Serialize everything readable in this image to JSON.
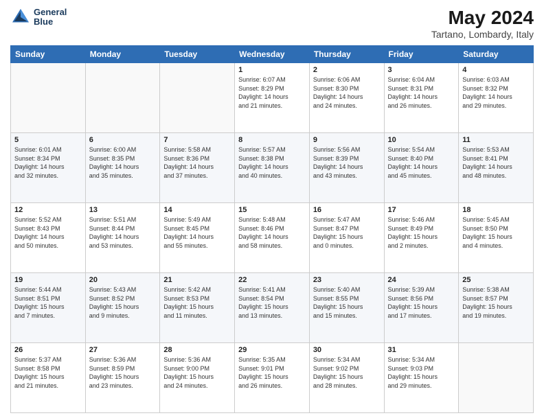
{
  "header": {
    "logo_line1": "General",
    "logo_line2": "Blue",
    "title": "May 2024",
    "subtitle": "Tartano, Lombardy, Italy"
  },
  "days_of_week": [
    "Sunday",
    "Monday",
    "Tuesday",
    "Wednesday",
    "Thursday",
    "Friday",
    "Saturday"
  ],
  "weeks": [
    [
      {
        "day": "",
        "info": ""
      },
      {
        "day": "",
        "info": ""
      },
      {
        "day": "",
        "info": ""
      },
      {
        "day": "1",
        "info": "Sunrise: 6:07 AM\nSunset: 8:29 PM\nDaylight: 14 hours\nand 21 minutes."
      },
      {
        "day": "2",
        "info": "Sunrise: 6:06 AM\nSunset: 8:30 PM\nDaylight: 14 hours\nand 24 minutes."
      },
      {
        "day": "3",
        "info": "Sunrise: 6:04 AM\nSunset: 8:31 PM\nDaylight: 14 hours\nand 26 minutes."
      },
      {
        "day": "4",
        "info": "Sunrise: 6:03 AM\nSunset: 8:32 PM\nDaylight: 14 hours\nand 29 minutes."
      }
    ],
    [
      {
        "day": "5",
        "info": "Sunrise: 6:01 AM\nSunset: 8:34 PM\nDaylight: 14 hours\nand 32 minutes."
      },
      {
        "day": "6",
        "info": "Sunrise: 6:00 AM\nSunset: 8:35 PM\nDaylight: 14 hours\nand 35 minutes."
      },
      {
        "day": "7",
        "info": "Sunrise: 5:58 AM\nSunset: 8:36 PM\nDaylight: 14 hours\nand 37 minutes."
      },
      {
        "day": "8",
        "info": "Sunrise: 5:57 AM\nSunset: 8:38 PM\nDaylight: 14 hours\nand 40 minutes."
      },
      {
        "day": "9",
        "info": "Sunrise: 5:56 AM\nSunset: 8:39 PM\nDaylight: 14 hours\nand 43 minutes."
      },
      {
        "day": "10",
        "info": "Sunrise: 5:54 AM\nSunset: 8:40 PM\nDaylight: 14 hours\nand 45 minutes."
      },
      {
        "day": "11",
        "info": "Sunrise: 5:53 AM\nSunset: 8:41 PM\nDaylight: 14 hours\nand 48 minutes."
      }
    ],
    [
      {
        "day": "12",
        "info": "Sunrise: 5:52 AM\nSunset: 8:43 PM\nDaylight: 14 hours\nand 50 minutes."
      },
      {
        "day": "13",
        "info": "Sunrise: 5:51 AM\nSunset: 8:44 PM\nDaylight: 14 hours\nand 53 minutes."
      },
      {
        "day": "14",
        "info": "Sunrise: 5:49 AM\nSunset: 8:45 PM\nDaylight: 14 hours\nand 55 minutes."
      },
      {
        "day": "15",
        "info": "Sunrise: 5:48 AM\nSunset: 8:46 PM\nDaylight: 14 hours\nand 58 minutes."
      },
      {
        "day": "16",
        "info": "Sunrise: 5:47 AM\nSunset: 8:47 PM\nDaylight: 15 hours\nand 0 minutes."
      },
      {
        "day": "17",
        "info": "Sunrise: 5:46 AM\nSunset: 8:49 PM\nDaylight: 15 hours\nand 2 minutes."
      },
      {
        "day": "18",
        "info": "Sunrise: 5:45 AM\nSunset: 8:50 PM\nDaylight: 15 hours\nand 4 minutes."
      }
    ],
    [
      {
        "day": "19",
        "info": "Sunrise: 5:44 AM\nSunset: 8:51 PM\nDaylight: 15 hours\nand 7 minutes."
      },
      {
        "day": "20",
        "info": "Sunrise: 5:43 AM\nSunset: 8:52 PM\nDaylight: 15 hours\nand 9 minutes."
      },
      {
        "day": "21",
        "info": "Sunrise: 5:42 AM\nSunset: 8:53 PM\nDaylight: 15 hours\nand 11 minutes."
      },
      {
        "day": "22",
        "info": "Sunrise: 5:41 AM\nSunset: 8:54 PM\nDaylight: 15 hours\nand 13 minutes."
      },
      {
        "day": "23",
        "info": "Sunrise: 5:40 AM\nSunset: 8:55 PM\nDaylight: 15 hours\nand 15 minutes."
      },
      {
        "day": "24",
        "info": "Sunrise: 5:39 AM\nSunset: 8:56 PM\nDaylight: 15 hours\nand 17 minutes."
      },
      {
        "day": "25",
        "info": "Sunrise: 5:38 AM\nSunset: 8:57 PM\nDaylight: 15 hours\nand 19 minutes."
      }
    ],
    [
      {
        "day": "26",
        "info": "Sunrise: 5:37 AM\nSunset: 8:58 PM\nDaylight: 15 hours\nand 21 minutes."
      },
      {
        "day": "27",
        "info": "Sunrise: 5:36 AM\nSunset: 8:59 PM\nDaylight: 15 hours\nand 23 minutes."
      },
      {
        "day": "28",
        "info": "Sunrise: 5:36 AM\nSunset: 9:00 PM\nDaylight: 15 hours\nand 24 minutes."
      },
      {
        "day": "29",
        "info": "Sunrise: 5:35 AM\nSunset: 9:01 PM\nDaylight: 15 hours\nand 26 minutes."
      },
      {
        "day": "30",
        "info": "Sunrise: 5:34 AM\nSunset: 9:02 PM\nDaylight: 15 hours\nand 28 minutes."
      },
      {
        "day": "31",
        "info": "Sunrise: 5:34 AM\nSunset: 9:03 PM\nDaylight: 15 hours\nand 29 minutes."
      },
      {
        "day": "",
        "info": ""
      }
    ]
  ]
}
